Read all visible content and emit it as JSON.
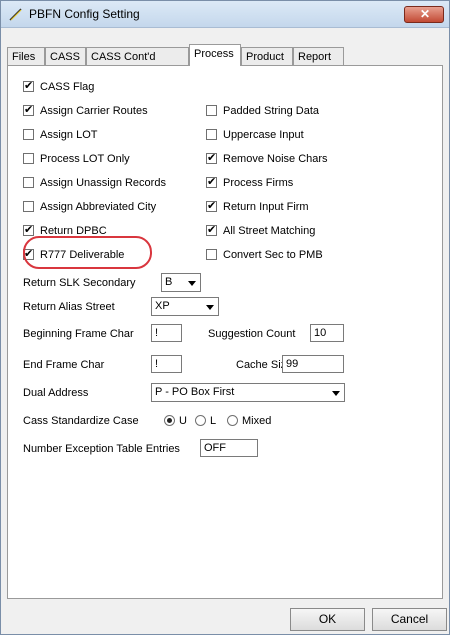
{
  "window": {
    "title": "PBFN Config Setting",
    "close_glyph": "✕",
    "close_color": "#c24a34"
  },
  "tabs": [
    "Files",
    "CASS",
    "CASS Cont'd",
    "Process",
    "Product",
    "Report"
  ],
  "active_tab": "Process",
  "checkboxes_left": [
    {
      "label": "CASS Flag",
      "checked": true
    },
    {
      "label": "Assign Carrier Routes",
      "checked": true
    },
    {
      "label": "Assign LOT",
      "checked": false
    },
    {
      "label": "Process LOT Only",
      "checked": false
    },
    {
      "label": "Assign Unassign Records",
      "checked": false
    },
    {
      "label": "Assign Abbreviated City",
      "checked": false
    },
    {
      "label": "Return DPBC",
      "checked": true
    },
    {
      "label": "R777 Deliverable",
      "checked": true
    }
  ],
  "checkboxes_right": [
    {
      "label": "Padded String Data",
      "checked": false
    },
    {
      "label": "Uppercase Input",
      "checked": false
    },
    {
      "label": "Remove Noise Chars",
      "checked": true
    },
    {
      "label": "Process Firms",
      "checked": true
    },
    {
      "label": "Return Input Firm",
      "checked": true
    },
    {
      "label": "All Street Matching",
      "checked": true
    },
    {
      "label": "Convert Sec to PMB",
      "checked": false
    }
  ],
  "fields": {
    "slk_label": "Return SLK Secondary",
    "slk_value": "B",
    "alias_label": "Return Alias Street",
    "alias_value": "XP",
    "begin_frame_label": "Beginning Frame Char",
    "begin_frame_value": "!",
    "suggestion_label": "Suggestion Count",
    "suggestion_value": "10",
    "end_frame_label": "End Frame Char",
    "end_frame_value": "!",
    "cache_label": "Cache Size",
    "cache_value": "99",
    "dual_label": "Dual Address",
    "dual_value": "P - PO Box First",
    "case_label": "Cass Standardize Case",
    "case_options": [
      "U",
      "L",
      "Mixed"
    ],
    "case_selected": "U",
    "exception_label": "Number Exception Table Entries",
    "exception_value": "OFF"
  },
  "buttons": {
    "ok": "OK",
    "cancel": "Cancel"
  },
  "highlight_color": "#d9363e"
}
